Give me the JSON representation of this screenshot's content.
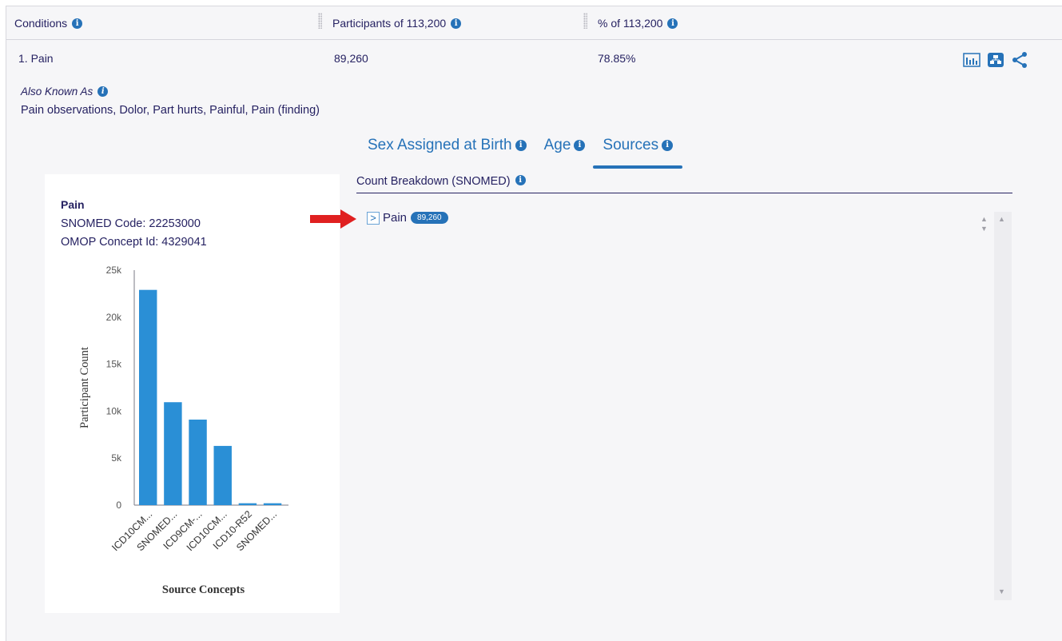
{
  "header": {
    "conditions_label": "Conditions",
    "participants_label": "Participants of 113,200",
    "percent_label": "% of 113,200"
  },
  "row": {
    "name": "1. Pain",
    "participants": "89,260",
    "percent": "78.85%",
    "icons": [
      "bar-chart-icon",
      "hierarchy-icon",
      "share-icon"
    ]
  },
  "aka": {
    "title": "Also Known As",
    "text": "Pain observations, Dolor, Part hurts, Painful, Pain (finding)"
  },
  "tabs": [
    {
      "label": "Sex Assigned at Birth",
      "active": false
    },
    {
      "label": "Age",
      "active": false
    },
    {
      "label": "Sources",
      "active": true
    }
  ],
  "card": {
    "title": "Pain",
    "snomed_code": "SNOMED Code: 22253000",
    "omop_id": "OMOP Concept Id: 4329041"
  },
  "count_breakdown": {
    "label": "Count Breakdown (SNOMED)",
    "tree_item": "Pain",
    "tree_badge": "89,260"
  },
  "colors": {
    "accent": "#2672b8",
    "bar": "#2a8fd6",
    "text": "#262262",
    "arrow": "#e02020"
  },
  "chart_data": {
    "type": "bar",
    "categories": [
      "ICD10CM...",
      "SNOMED...",
      "ICD9CM-...",
      "ICD10CM...",
      "ICD10-R52",
      "SNOMED..."
    ],
    "values": [
      22900,
      10950,
      9100,
      6300,
      200,
      200
    ],
    "ylim": [
      0,
      25000
    ],
    "yticks": [
      0,
      5000,
      10000,
      15000,
      20000,
      25000
    ],
    "ytick_labels": [
      "0",
      "5k",
      "10k",
      "15k",
      "20k",
      "25k"
    ],
    "xlabel": "Source Concepts",
    "ylabel": "Participant Count",
    "grid": false,
    "legend": "none"
  }
}
